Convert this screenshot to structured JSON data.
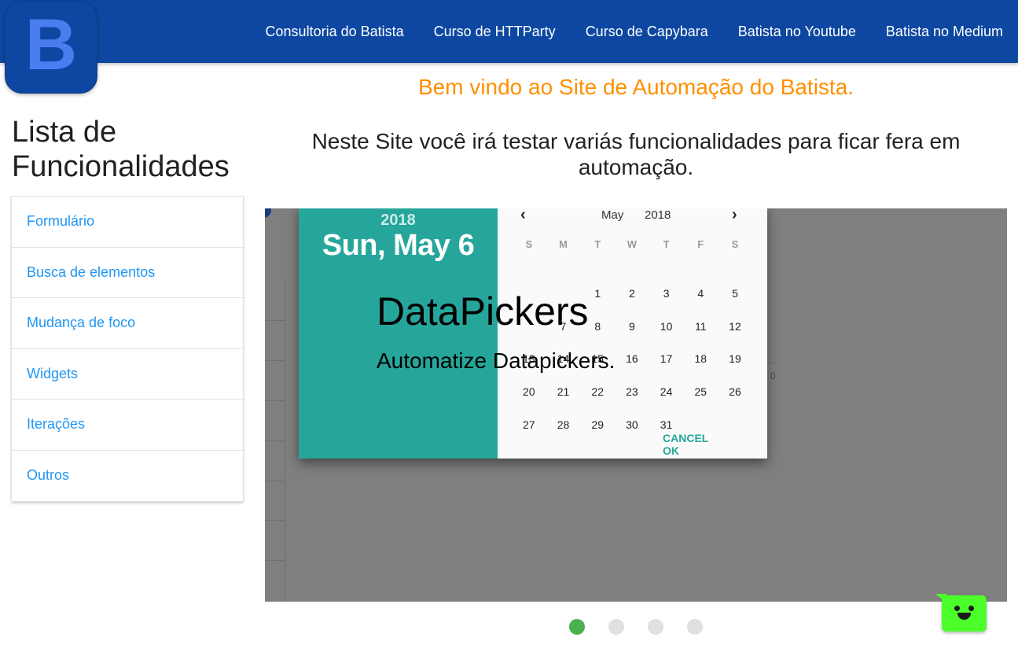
{
  "logo": {
    "letter": "B"
  },
  "nav": {
    "links": [
      "Consultoria do Batista",
      "Curso de HTTParty",
      "Curso de Capybara",
      "Batista no Youtube",
      "Batista no Medium"
    ]
  },
  "header": {
    "welcome": "Bem vindo ao Site de Automação do Batista.",
    "intro": "Neste Site você irá testar variás funcionalidades para ficar fera em automação."
  },
  "sidebar": {
    "title": "Lista de Funcionalidades",
    "items": [
      "Formulário",
      "Busca de elementos",
      "Mudança de foco",
      "Widgets",
      "Iterações",
      "Outros"
    ]
  },
  "carousel": {
    "caption_title": "DataPickers",
    "caption_text": "Automatize Datapickers.",
    "slide_count": 4,
    "active_index": 0,
    "background_axis_label": "0",
    "datepicker": {
      "header_year": "2018",
      "header_date": "Sun, May 6",
      "prev_icon": "chevron-left-icon",
      "next_icon": "chevron-right-icon",
      "month": "May",
      "year": "2018",
      "weekdays": [
        "S",
        "M",
        "T",
        "W",
        "T",
        "F",
        "S"
      ],
      "days": [
        "",
        "",
        "1",
        "2",
        "3",
        "4",
        "5",
        "",
        "7",
        "8",
        "9",
        "10",
        "11",
        "12",
        "13",
        "14",
        "15",
        "16",
        "17",
        "18",
        "19",
        "20",
        "21",
        "22",
        "23",
        "24",
        "25",
        "26",
        "27",
        "28",
        "29",
        "30",
        "31",
        "",
        ""
      ],
      "cancel_label": "CANCEL",
      "ok_label": "OK"
    }
  },
  "chatbot": {
    "icon": "chat-bot-icon"
  },
  "colors": {
    "nav_bg": "#0d47a1",
    "welcome": "#ff8f00",
    "link": "#2196f3",
    "datepicker_accent": "#26a69a",
    "indicator_active": "#4caf50",
    "chatbot": "#4cff2a"
  }
}
